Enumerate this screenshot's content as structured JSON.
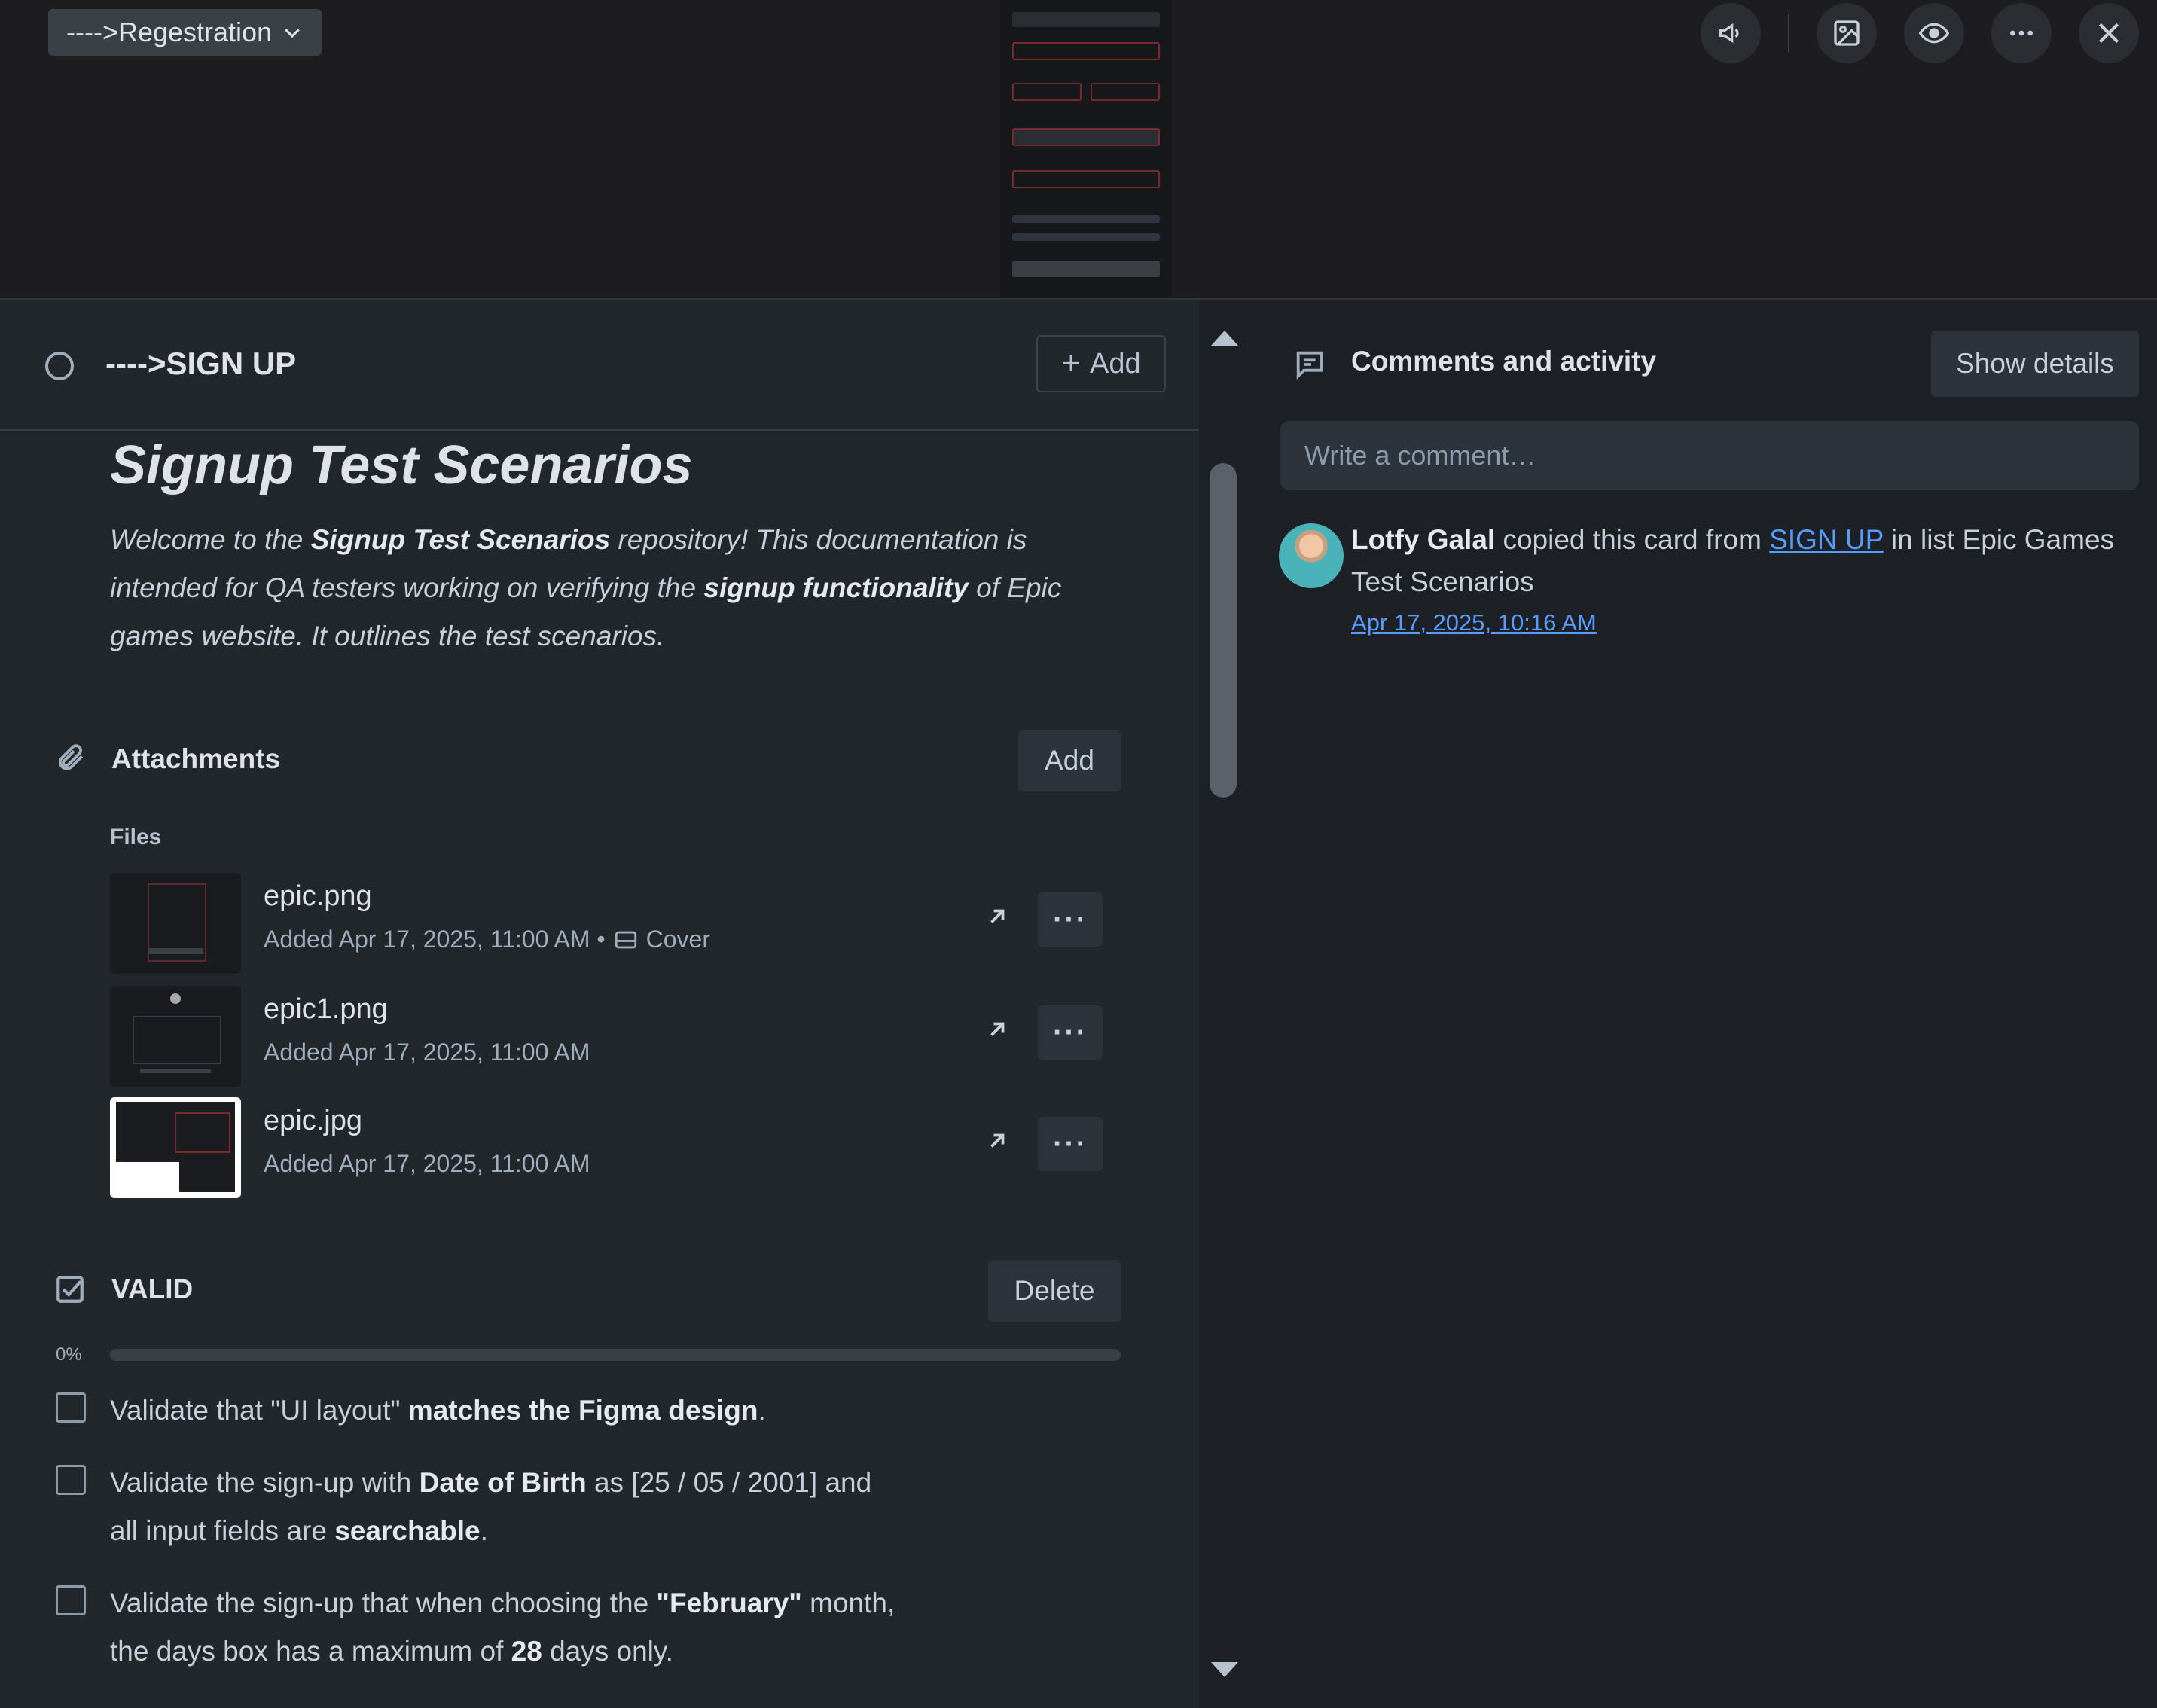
{
  "header": {
    "list_button_label": "---->Regestration",
    "icons": [
      "megaphone-icon",
      "image-icon",
      "eye-icon",
      "more-icon",
      "close-icon"
    ]
  },
  "card": {
    "title": "---->SIGN UP",
    "add_label": "Add"
  },
  "description": {
    "heading": "Signup Test Scenarios",
    "p1": "Welcome to the ",
    "p1_bold": "Signup Test Scenarios",
    "p2": " repository! This documentation is intended for QA testers working on verifying the ",
    "p2_bold": "signup functionality",
    "p3": " of Epic games website. It outlines the test scenarios."
  },
  "attachments": {
    "title": "Attachments",
    "add_label": "Add",
    "files_label": "Files",
    "files": [
      {
        "name": "epic.png",
        "meta": "Added Apr 17, 2025, 11:00 AM •",
        "cover_label": "Cover"
      },
      {
        "name": "epic1.png",
        "meta": "Added Apr 17, 2025, 11:00 AM"
      },
      {
        "name": "epic.jpg",
        "meta": "Added Apr 17, 2025, 11:00 AM"
      }
    ]
  },
  "checklist": {
    "title": "VALID",
    "delete_label": "Delete",
    "progress_label": "0%",
    "progress": 0,
    "items": [
      {
        "a": "Validate that \"UI layout\" ",
        "b": "matches the Figma design",
        "c": "."
      },
      {
        "a": "Validate the sign-up with ",
        "b": "Date of Birth",
        "c": " as [25 / 05 / 2001] and",
        "d": "all input fields are ",
        "e": "searchable",
        "f": "."
      },
      {
        "a": "Validate the sign-up that when choosing the ",
        "b": "\"February\"",
        "c": " month,",
        "d": "the days box has a maximum of ",
        "e": "28",
        "f": " days only."
      }
    ]
  },
  "comments": {
    "title": "Comments and activity",
    "show_details_label": "Show details",
    "input_placeholder": "Write a comment…",
    "activity": {
      "user": "Lotfy Galal",
      "text1": " copied this card from ",
      "link": "SIGN UP",
      "text2": " in list Epic Games Test Scenarios",
      "date": "Apr 17, 2025, 10:16 AM"
    }
  },
  "colors": {
    "accent": "#579dff",
    "panel_bg": "#22272b",
    "page_bg": "#1d2125"
  }
}
